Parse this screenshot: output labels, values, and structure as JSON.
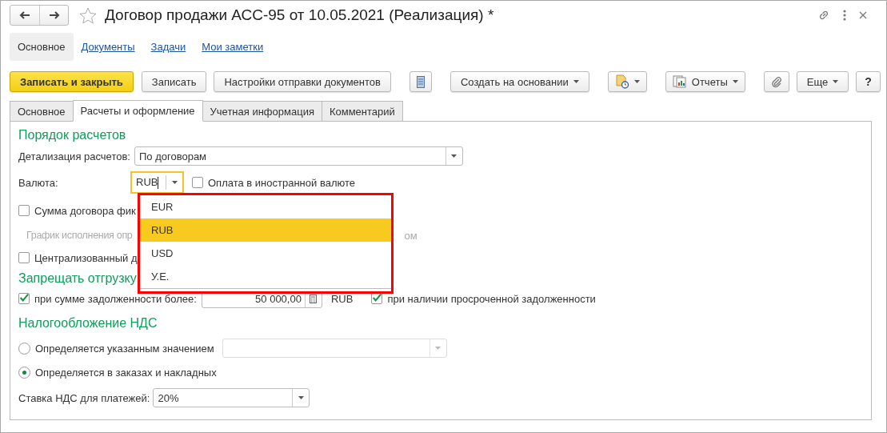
{
  "window": {
    "title": "Договор продажи АСС-95 от 10.05.2021 (Реализация) *"
  },
  "nav": [
    {
      "label": "Основное",
      "selected": true
    },
    {
      "label": "Документы",
      "selected": false
    },
    {
      "label": "Задачи",
      "selected": false
    },
    {
      "label": "Мои заметки",
      "selected": false
    }
  ],
  "toolbar": [
    {
      "kind": "primary",
      "label": "Записать и закрыть"
    },
    {
      "kind": "plain",
      "label": "Записать"
    },
    {
      "kind": "plain",
      "label": "Настройки отправки документов"
    },
    {
      "kind": "list"
    },
    {
      "kind": "menu",
      "label": "Создать на основании"
    },
    {
      "kind": "docmenu"
    },
    {
      "kind": "reports",
      "label": "Отчеты"
    },
    {
      "kind": "clip"
    }
  ],
  "toolbar_right": [
    {
      "kind": "menu",
      "label": "Еще"
    },
    {
      "kind": "plain",
      "label": "?"
    }
  ],
  "tabs": [
    {
      "label": "Основное",
      "selected": false
    },
    {
      "label": "Расчеты и оформление",
      "selected": true
    },
    {
      "label": "Учетная информация",
      "selected": false
    },
    {
      "label": "Комментарий",
      "selected": false
    }
  ],
  "settlement": {
    "heading": "Порядок расчетов",
    "detail": {
      "label": "Детализация расчетов:",
      "value": "По договорам"
    },
    "currency": {
      "label": "Валюта:",
      "value": "RUB",
      "foreign": {
        "label": "Оплата в иностранной валюте",
        "checked": false
      }
    },
    "fixed_sum": {
      "label": "Сумма договора фик",
      "checked": false
    },
    "schedule": {
      "label": "График исполнения опр",
      "tail": "ом",
      "disabled": true
    },
    "centralized": {
      "label": "Централизованный д",
      "checked": false
    }
  },
  "shipment": {
    "heading": "Запрещать отгрузку",
    "debt": {
      "label": "при сумме задолженности более:",
      "checked": true,
      "value": "50 000,00",
      "currency": "RUB"
    },
    "overdue": {
      "label": "при наличии просроченной задолженности",
      "checked": true
    }
  },
  "vat": {
    "heading": "Налогообложение НДС",
    "options": [
      {
        "kind": "field",
        "label": "Определяется указанным значением",
        "selected": false
      },
      {
        "kind": "plain",
        "label": "Определяется в заказах и накладных",
        "selected": true
      }
    ],
    "rate": {
      "label": "Ставка НДС для платежей:",
      "value": "20%"
    }
  },
  "currency_dropdown": [
    {
      "label": "EUR",
      "selected": false
    },
    {
      "label": "RUB",
      "selected": true
    },
    {
      "label": "USD",
      "selected": false
    },
    {
      "label": "У.Е.",
      "selected": false
    }
  ]
}
